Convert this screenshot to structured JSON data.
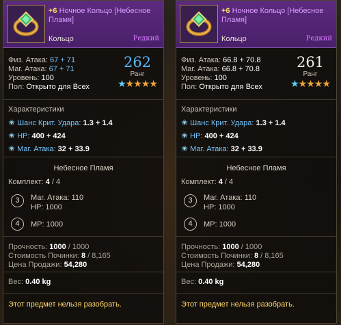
{
  "colors": {
    "title_purple": "#d99cff",
    "stat_blue": "#74c6ff",
    "rank_blue": "#58b8ff",
    "warning_yellow": "#ffd86b",
    "header_bg": "#5c2a7e"
  },
  "cards": [
    {
      "title_plus": "+6",
      "title": "Ночное Кольцо [Небесное Пламя]",
      "type": "Кольцо",
      "rarity": "Редкий",
      "icon": "ring-icon",
      "phys_label": "Физ. Атака:",
      "phys_value": "67 + 71",
      "mag_label": "Маг. Атака:",
      "mag_value": "67 + 71",
      "level_label": "Уровень:",
      "level_value": "100",
      "gender_label": "Пол:",
      "gender_value": "Открыто для Всех",
      "rank_value": "262",
      "rank_label": "Ранг",
      "stars": "★★★★★",
      "chars_title": "Характеристики",
      "chars": [
        {
          "label": "Шанс Крит. Удара:",
          "value": "1.3 + 1.4"
        },
        {
          "label": "HP:",
          "value": "400 + 424"
        },
        {
          "label": "Маг. Атака:",
          "value": "32 + 33.9"
        }
      ],
      "set_name": "Небесное Пламя",
      "set_label": "Комплект:",
      "set_have": "4",
      "set_total": "/ 4",
      "bonuses": [
        {
          "num": "3",
          "lines": [
            "Маг. Атака: 110",
            "HP: 1000"
          ]
        },
        {
          "num": "4",
          "lines": [
            "MP: 1000"
          ]
        }
      ],
      "durability_label": "Прочность:",
      "durability_value": "1000",
      "durability_max": "/ 1000",
      "repair_label": "Стоимость Починки:",
      "repair_value": "8",
      "repair_max": "/ 8,165",
      "sell_label": "Цена Продажи:",
      "sell_value": "54,280",
      "weight_label": "Вес:",
      "weight_value": "0.40 kg",
      "warning": "Этот предмет нельзя разобрать."
    },
    {
      "title_plus": "+6",
      "title": "Ночное Кольцо [Небесное Пламя]",
      "type": "Кольцо",
      "rarity": "Редкий",
      "icon": "ring-icon",
      "phys_label": "Физ. Атака:",
      "phys_value": "66.8 + 70.8",
      "mag_label": "Маг. Атака:",
      "mag_value": "66.8 + 70.8",
      "level_label": "Уровень:",
      "level_value": "100",
      "gender_label": "Пол:",
      "gender_value": "Открыто для Всех",
      "rank_value": "261",
      "rank_label": "Ранг",
      "stars": "★★★★★",
      "chars_title": "Характеристики",
      "chars": [
        {
          "label": "Шанс Крит. Удара:",
          "value": "1.3 + 1.4"
        },
        {
          "label": "HP:",
          "value": "400 + 424"
        },
        {
          "label": "Маг. Атака:",
          "value": "32 + 33.9"
        }
      ],
      "set_name": "Небесное Пламя",
      "set_label": "Комплект:",
      "set_have": "4",
      "set_total": "/ 4",
      "bonuses": [
        {
          "num": "3",
          "lines": [
            "Маг. Атака: 110",
            "HP: 1000"
          ]
        },
        {
          "num": "4",
          "lines": [
            "MP: 1000"
          ]
        }
      ],
      "durability_label": "Прочность:",
      "durability_value": "1000",
      "durability_max": "/ 1000",
      "repair_label": "Стоимость Починки:",
      "repair_value": "8",
      "repair_max": "/ 8,165",
      "sell_label": "Цена Продажи:",
      "sell_value": "54,280",
      "weight_label": "Вес:",
      "weight_value": "0.40 kg",
      "warning": "Этот предмет нельзя разобрать."
    }
  ]
}
